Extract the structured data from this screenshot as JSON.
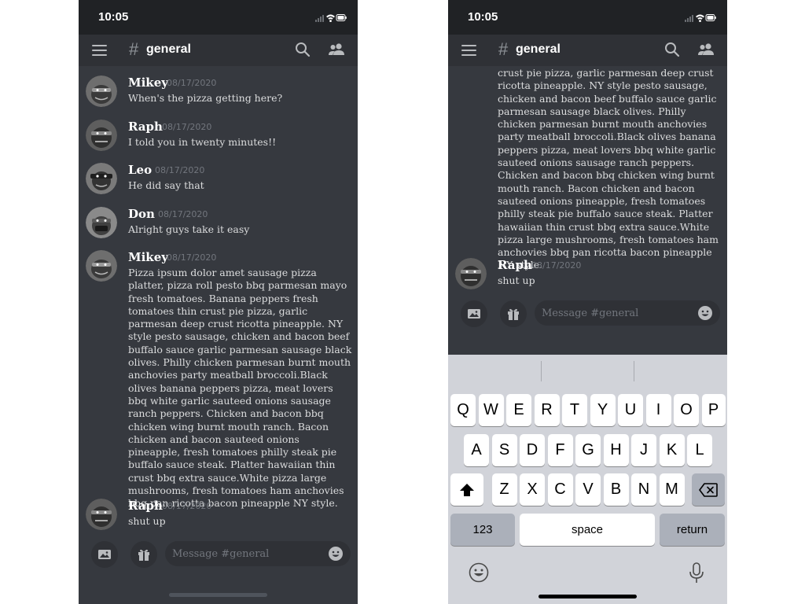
{
  "status_bar": {
    "time": "10:05"
  },
  "channel": {
    "hash": "#",
    "name": "general"
  },
  "messages": [
    {
      "author": "Mikey",
      "date": "08/17/2020",
      "text": "When's the pizza getting here?"
    },
    {
      "author": "Raph",
      "date": "08/17/2020",
      "text": "I told you in twenty minutes!!"
    },
    {
      "author": "Leo",
      "date": "08/17/2020",
      "text": "He did say that"
    },
    {
      "author": "Don",
      "date": "08/17/2020",
      "text": "Alright guys take it easy"
    },
    {
      "author": "Mikey",
      "date": "08/17/2020",
      "text": "Pizza ipsum dolor amet sausage pizza platter, pizza roll pesto bbq parmesan mayo fresh tomatoes. Banana peppers fresh tomatoes thin crust pie pizza, garlic parmesan deep crust ricotta pineapple. NY style pesto sausage, chicken and bacon beef buffalo sauce garlic parmesan sausage black olives. Philly chicken parmesan burnt mouth anchovies party meatball broccoli.Black olives banana peppers pizza, meat lovers bbq white garlic sauteed onions sausage ranch peppers. Chicken and bacon bbq chicken wing burnt mouth ranch. Bacon chicken and bacon sauteed onions pineapple, fresh tomatoes philly steak pie buffalo sauce steak. Platter hawaiian thin crust bbq extra sauce.White pizza large mushrooms, fresh tomatoes ham anchovies bbq pan ricotta bacon pineapple NY style."
    },
    {
      "author": "Raph",
      "date": "08/17/2020",
      "text": "shut up"
    }
  ],
  "right_partial_text": "crust pie pizza, garlic parmesan deep crust ricotta pineapple. NY style pesto sausage, chicken and bacon beef buffalo sauce garlic parmesan sausage black olives. Philly chicken parmesan burnt mouth anchovies party meatball broccoli.Black olives banana peppers pizza, meat lovers bbq white garlic sauteed onions sausage ranch peppers. Chicken and bacon bbq chicken wing burnt mouth ranch. Bacon chicken and bacon sauteed onions pineapple, fresh tomatoes philly steak pie buffalo sauce steak. Platter hawaiian thin crust bbq extra sauce.White pizza large mushrooms, fresh tomatoes ham anchovies bbq pan ricotta bacon pineapple NY style.",
  "composer": {
    "placeholder": "Message #general",
    "value": ""
  },
  "keyboard": {
    "row1": [
      "Q",
      "W",
      "E",
      "R",
      "T",
      "Y",
      "U",
      "I",
      "O",
      "P"
    ],
    "row2": [
      "A",
      "S",
      "D",
      "F",
      "G",
      "H",
      "J",
      "K",
      "L"
    ],
    "row3": [
      "Z",
      "X",
      "C",
      "V",
      "B",
      "N",
      "M"
    ],
    "numbers_label": "123",
    "space_label": "space",
    "return_label": "return"
  },
  "icons": {
    "menu": "hamburger-menu-icon",
    "search": "search-icon",
    "members": "members-icon",
    "image": "image-icon",
    "gift": "gift-icon",
    "emoji": "emoji-icon",
    "shift": "shift-icon",
    "backspace": "backspace-icon",
    "keyboard_emoji": "keyboard-emoji-icon",
    "mic": "microphone-icon"
  },
  "colors": {
    "background": "#36393f",
    "nav_bar": "#2f3136",
    "status_bar": "#202225",
    "text_primary": "#ffffff",
    "text_body": "#dcddde",
    "text_muted": "#72767d",
    "keyboard_bg": "#d1d3d9"
  }
}
